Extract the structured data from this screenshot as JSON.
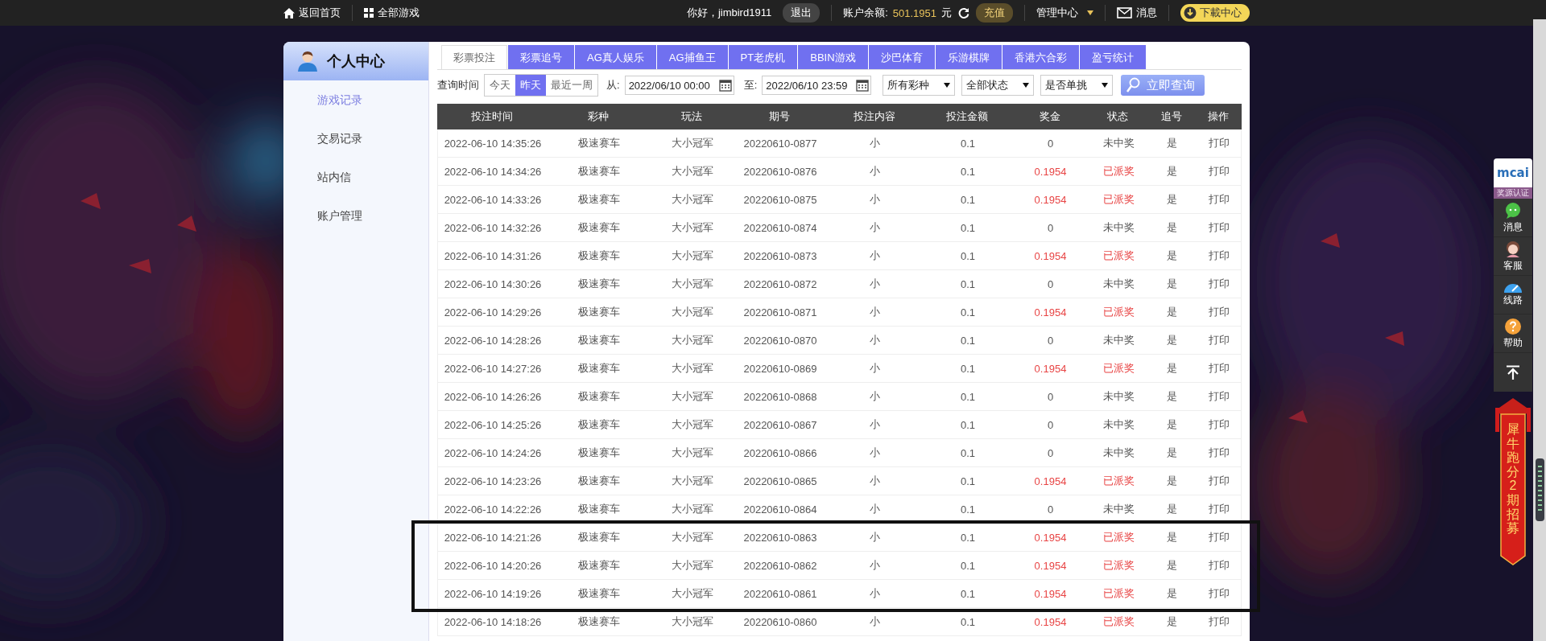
{
  "top_bar": {
    "home_link": "返回首页",
    "games_link": "全部游戏",
    "greeting": "你好，jimbird1911",
    "logout": "退出",
    "balance_label": "账户余额:",
    "balance": "501.1951",
    "currency": "元",
    "recharge": "充值",
    "admin_menu": "管理中心",
    "messages": "消息",
    "download": "下載中心"
  },
  "sidebar": {
    "title": "个人中心",
    "items": [
      {
        "label": "游戏记录",
        "selected": true
      },
      {
        "label": "交易记录",
        "selected": false
      },
      {
        "label": "站内信",
        "selected": false
      },
      {
        "label": "账户管理",
        "selected": false
      }
    ]
  },
  "tabs": [
    {
      "label": "彩票投注",
      "selected": true
    },
    {
      "label": "彩票追号",
      "selected": false
    },
    {
      "label": "AG真人娱乐",
      "selected": false
    },
    {
      "label": "AG捕鱼王",
      "selected": false
    },
    {
      "label": "PT老虎机",
      "selected": false
    },
    {
      "label": "BBIN游戏",
      "selected": false
    },
    {
      "label": "沙巴体育",
      "selected": false
    },
    {
      "label": "乐游棋牌",
      "selected": false
    },
    {
      "label": "香港六合彩",
      "selected": false
    },
    {
      "label": "盈亏统计",
      "selected": false
    }
  ],
  "filters": {
    "label": "查询时间",
    "ranges": [
      {
        "label": "今天",
        "selected": false
      },
      {
        "label": "昨天",
        "selected": true
      },
      {
        "label": "最近一周",
        "selected": false
      }
    ],
    "from_label": "从:",
    "from_value": "2022/06/10 00:00",
    "to_label": "至:",
    "to_value": "2022/06/10 23:59",
    "selects": [
      "所有彩种",
      "全部状态",
      "是否单挑"
    ],
    "search_button": "立即查询"
  },
  "table": {
    "columns": [
      "投注时间",
      "彩种",
      "玩法",
      "期号",
      "投注内容",
      "投注金额",
      "奖金",
      "状态",
      "追号",
      "操作"
    ],
    "rows": [
      {
        "cells": [
          "2022-06-10 14:35:26",
          "极速赛车",
          "大小冠军",
          "20220610-0877",
          "小",
          "0.1",
          "0",
          "未中奖",
          "是",
          "打印"
        ],
        "won": false
      },
      {
        "cells": [
          "2022-06-10 14:34:26",
          "极速赛车",
          "大小冠军",
          "20220610-0876",
          "小",
          "0.1",
          "0.1954",
          "已派奖",
          "是",
          "打印"
        ],
        "won": true
      },
      {
        "cells": [
          "2022-06-10 14:33:26",
          "极速赛车",
          "大小冠军",
          "20220610-0875",
          "小",
          "0.1",
          "0.1954",
          "已派奖",
          "是",
          "打印"
        ],
        "won": true
      },
      {
        "cells": [
          "2022-06-10 14:32:26",
          "极速赛车",
          "大小冠军",
          "20220610-0874",
          "小",
          "0.1",
          "0",
          "未中奖",
          "是",
          "打印"
        ],
        "won": false
      },
      {
        "cells": [
          "2022-06-10 14:31:26",
          "极速赛车",
          "大小冠军",
          "20220610-0873",
          "小",
          "0.1",
          "0.1954",
          "已派奖",
          "是",
          "打印"
        ],
        "won": true
      },
      {
        "cells": [
          "2022-06-10 14:30:26",
          "极速赛车",
          "大小冠军",
          "20220610-0872",
          "小",
          "0.1",
          "0",
          "未中奖",
          "是",
          "打印"
        ],
        "won": false
      },
      {
        "cells": [
          "2022-06-10 14:29:26",
          "极速赛车",
          "大小冠军",
          "20220610-0871",
          "小",
          "0.1",
          "0.1954",
          "已派奖",
          "是",
          "打印"
        ],
        "won": true
      },
      {
        "cells": [
          "2022-06-10 14:28:26",
          "极速赛车",
          "大小冠军",
          "20220610-0870",
          "小",
          "0.1",
          "0",
          "未中奖",
          "是",
          "打印"
        ],
        "won": false
      },
      {
        "cells": [
          "2022-06-10 14:27:26",
          "极速赛车",
          "大小冠军",
          "20220610-0869",
          "小",
          "0.1",
          "0.1954",
          "已派奖",
          "是",
          "打印"
        ],
        "won": true
      },
      {
        "cells": [
          "2022-06-10 14:26:26",
          "极速赛车",
          "大小冠军",
          "20220610-0868",
          "小",
          "0.1",
          "0",
          "未中奖",
          "是",
          "打印"
        ],
        "won": false
      },
      {
        "cells": [
          "2022-06-10 14:25:26",
          "极速赛车",
          "大小冠军",
          "20220610-0867",
          "小",
          "0.1",
          "0",
          "未中奖",
          "是",
          "打印"
        ],
        "won": false
      },
      {
        "cells": [
          "2022-06-10 14:24:26",
          "极速赛车",
          "大小冠军",
          "20220610-0866",
          "小",
          "0.1",
          "0",
          "未中奖",
          "是",
          "打印"
        ],
        "won": false
      },
      {
        "cells": [
          "2022-06-10 14:23:26",
          "极速赛车",
          "大小冠军",
          "20220610-0865",
          "小",
          "0.1",
          "0.1954",
          "已派奖",
          "是",
          "打印"
        ],
        "won": true
      },
      {
        "cells": [
          "2022-06-10 14:22:26",
          "极速赛车",
          "大小冠军",
          "20220610-0864",
          "小",
          "0.1",
          "0",
          "未中奖",
          "是",
          "打印"
        ],
        "won": false
      },
      {
        "cells": [
          "2022-06-10 14:21:26",
          "极速赛车",
          "大小冠军",
          "20220610-0863",
          "小",
          "0.1",
          "0.1954",
          "已派奖",
          "是",
          "打印"
        ],
        "won": true
      },
      {
        "cells": [
          "2022-06-10 14:20:26",
          "极速赛车",
          "大小冠军",
          "20220610-0862",
          "小",
          "0.1",
          "0.1954",
          "已派奖",
          "是",
          "打印"
        ],
        "won": true
      },
      {
        "cells": [
          "2022-06-10 14:19:26",
          "极速赛车",
          "大小冠军",
          "20220610-0861",
          "小",
          "0.1",
          "0.1954",
          "已派奖",
          "是",
          "打印"
        ],
        "won": true
      },
      {
        "cells": [
          "2022-06-10 14:18:26",
          "极速赛车",
          "大小冠军",
          "20220610-0860",
          "小",
          "0.1",
          "0.1954",
          "已派奖",
          "是",
          "打印"
        ],
        "won": true
      }
    ]
  },
  "side_widgets": {
    "logo": "mcai",
    "badge": "奖源认证",
    "items": [
      {
        "label": "消息",
        "kind": "chat"
      },
      {
        "label": "客服",
        "kind": "support"
      },
      {
        "label": "线路",
        "kind": "gauge"
      },
      {
        "label": "帮助",
        "kind": "help"
      }
    ],
    "banner": "犀牛跑分2期招募"
  }
}
